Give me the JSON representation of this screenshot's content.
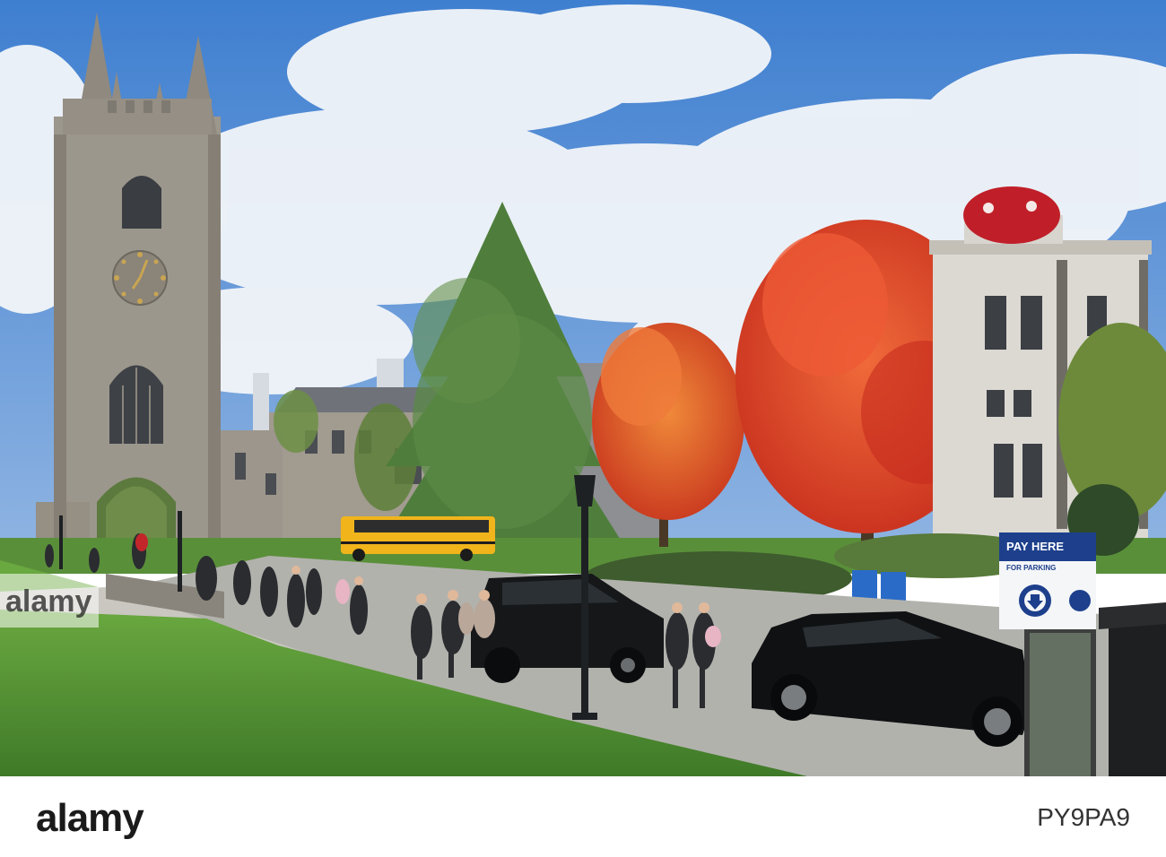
{
  "scene": {
    "description_elements": [
      "clock-tower",
      "campus-buildings",
      "evergreen-tree",
      "red-maple-trees",
      "school-bus",
      "dark-minivan",
      "dark-sedan",
      "students",
      "parking-sign",
      "lamp-post"
    ],
    "colors": {
      "sky": "#5b8fd4",
      "cloud": "#eef2f7",
      "stone": "#9a958b",
      "grass": "#5a9a3a",
      "red_tree": "#d8412a",
      "orange_tree": "#e0592c",
      "green_tree": "#4d7a3c",
      "bus": "#f2b81a",
      "car": "#111315",
      "dome": "#c0202a"
    }
  },
  "parking_sign": {
    "line1": "PAY HERE",
    "line2": "FOR PARKING"
  },
  "watermark": {
    "text": "alamy"
  },
  "footer": {
    "logo": "alamy",
    "image_id": "PY9PA9"
  }
}
